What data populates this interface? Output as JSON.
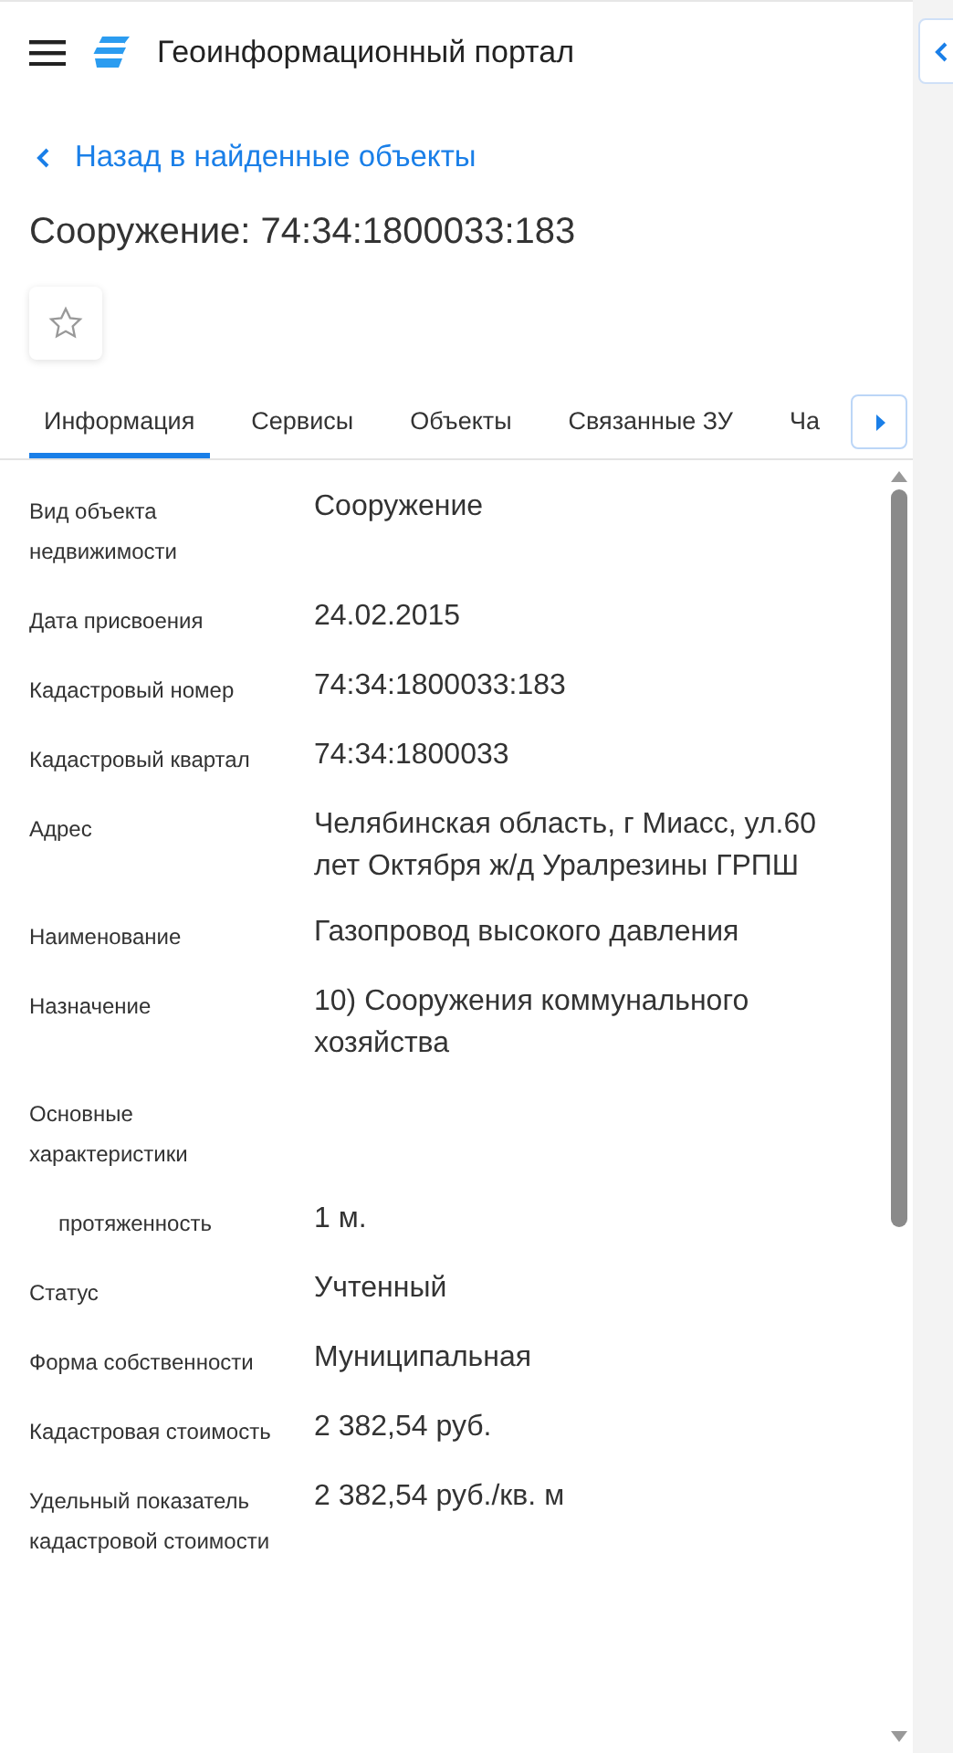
{
  "header": {
    "title": "Геоинформационный портал"
  },
  "back_link": "Назад в найденные объекты",
  "title": "Сооружение: 74:34:1800033:183",
  "favorite": {
    "selected": false
  },
  "tabs": [
    {
      "label": "Информация",
      "selected": true
    },
    {
      "label": "Сервисы",
      "selected": false
    },
    {
      "label": "Объекты",
      "selected": false
    },
    {
      "label": "Связанные ЗУ",
      "selected": false
    },
    {
      "label": "Ча",
      "selected": false
    }
  ],
  "fields": [
    {
      "label": "Вид объекта недвижимости",
      "value": "Сооружение"
    },
    {
      "label": "Дата присвоения",
      "value": "24.02.2015"
    },
    {
      "label": "Кадастровый номер",
      "value": "74:34:1800033:183"
    },
    {
      "label": "Кадастровый квартал",
      "value": "74:34:1800033"
    },
    {
      "label": "Адрес",
      "value": "Челябинская область, г Миасс, ул.60 лет Октября ж/д Уралрезины ГРПШ"
    },
    {
      "label": "Наименование",
      "value": "Газопровод высокого давления"
    },
    {
      "label": "Назначение",
      "value": "10) Сооружения коммунального хозяйства"
    },
    {
      "label": "Основные характеристики",
      "children": [
        {
          "label": "протяженность",
          "value": "1 м."
        }
      ]
    },
    {
      "label": "Статус",
      "value": "Учтенный"
    },
    {
      "label": "Форма собственности",
      "value": "Муниципальная"
    },
    {
      "label": "Кадастровая стоимость",
      "value": "2 382,54 руб."
    },
    {
      "label": "Удельный показатель кадастровой стоимости",
      "value": "2 382,54 руб./кв. м"
    }
  ]
}
